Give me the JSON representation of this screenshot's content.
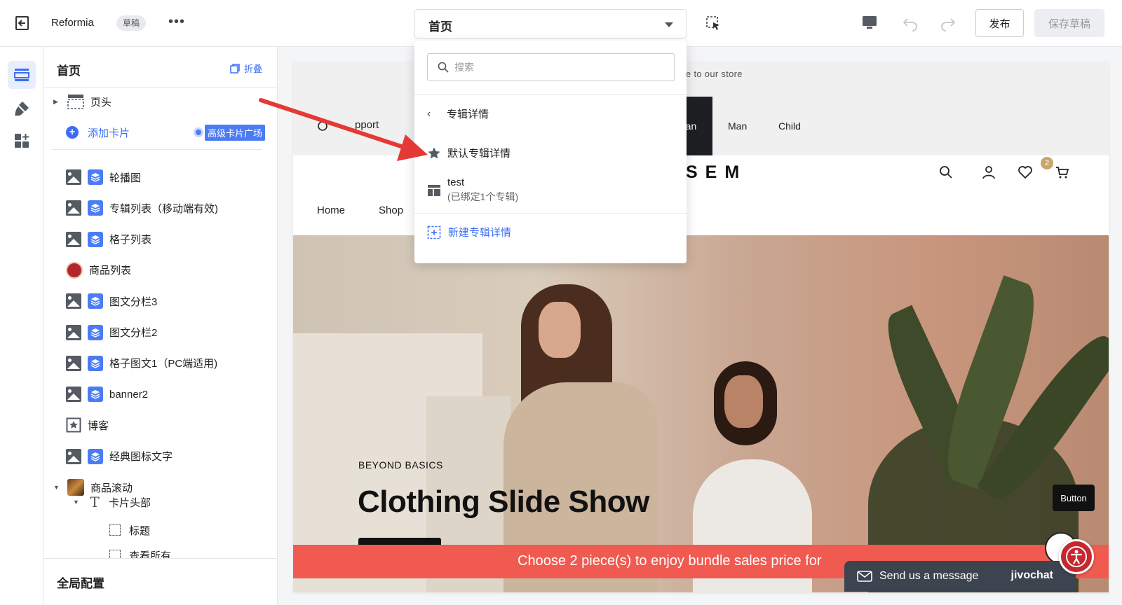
{
  "topbar": {
    "app_name": "Reformia",
    "draft_badge": "草稿",
    "more": "•••",
    "page_select_value": "首页",
    "publish_label": "发布",
    "save_draft_label": "保存草稿"
  },
  "rail": {
    "items": [
      {
        "icon": "sections-icon",
        "active": true
      },
      {
        "icon": "brush-icon",
        "active": false
      },
      {
        "icon": "apps-add-icon",
        "active": false
      }
    ]
  },
  "panel": {
    "title": "首页",
    "collapse_label": "折叠",
    "header_item": "页头",
    "add_card_label": "添加卡片",
    "premium_tag": "高级卡片广场",
    "sections": [
      {
        "label": "轮播图",
        "icons": [
          "image-icon",
          "layers-icon"
        ]
      },
      {
        "label": "专辑列表（移动端有效)",
        "icons": [
          "image-icon",
          "layers-icon"
        ]
      },
      {
        "label": "格子列表",
        "icons": [
          "image-icon",
          "layers-icon"
        ]
      },
      {
        "label": "商品列表",
        "icons": [
          "product-badge-icon"
        ]
      },
      {
        "label": "图文分栏3",
        "icons": [
          "image-icon",
          "layers-icon"
        ]
      },
      {
        "label": "图文分栏2",
        "icons": [
          "image-icon",
          "layers-icon"
        ]
      },
      {
        "label": "格子图文1（PC端适用)",
        "icons": [
          "image-icon",
          "layers-icon"
        ]
      },
      {
        "label": "banner2",
        "icons": [
          "image-icon",
          "layers-icon"
        ]
      },
      {
        "label": "博客",
        "icons": [
          "star-frame-icon"
        ]
      },
      {
        "label": "经典图标文字",
        "icons": [
          "image-icon",
          "layers-icon"
        ]
      },
      {
        "label": "商品滚动",
        "icons": [
          "product-thumb-icon"
        ]
      }
    ],
    "sub_header_label": "卡片头部",
    "sub_items": [
      "标题",
      "查看所有"
    ],
    "global_label": "全局配置"
  },
  "dropdown": {
    "search_placeholder": "搜索",
    "back_label": "专辑详情",
    "items": [
      {
        "label": "默认专辑详情",
        "icon": "star-icon"
      },
      {
        "label": "test",
        "sub": "(已绑定1个专辑)",
        "icon": "layout-icon"
      }
    ],
    "new_label": "新建专辑详情"
  },
  "preview": {
    "announcement": "e to our store",
    "support_label": "pport",
    "gender_tabs": [
      "man",
      "Man",
      "Child"
    ],
    "logo": "SEM",
    "nav": [
      "Home",
      "Shop"
    ],
    "wishlist_count": "2",
    "hero_eyebrow": "BEYOND BASICS",
    "hero_title": "Clothing Slide Show",
    "float_button": "Button",
    "promo_text": "Choose 2 piece(s) to enjoy bundle sales price for",
    "chat_label": "Send us a message",
    "chat_brand": "jivochat"
  },
  "colors": {
    "accent": "#3b6ef5",
    "promo": "#f05a50",
    "annotation_arrow": "#e53935"
  }
}
